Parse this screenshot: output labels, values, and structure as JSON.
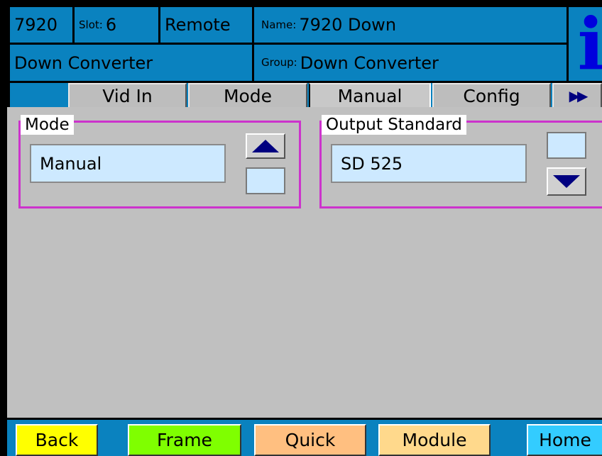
{
  "header": {
    "model": "7920",
    "slot_label": "Slot:",
    "slot_value": "6",
    "remote_label": "Remote",
    "name_label": "Name:",
    "name_value": "7920 Down",
    "device_type": "Down Converter",
    "group_label": "Group:",
    "group_value": "Down Converter",
    "info_glyph": "i"
  },
  "tabs": [
    {
      "label": "Vid In"
    },
    {
      "label": "Mode"
    },
    {
      "label": "Manual"
    },
    {
      "label": "Config"
    }
  ],
  "tabs_more_glyph": "▶▶",
  "mode_panel": {
    "title": "Mode",
    "value": "Manual"
  },
  "output_panel": {
    "title": "Output Standard",
    "value": "SD 525"
  },
  "footer": {
    "back": "Back",
    "frame": "Frame",
    "quick": "Quick",
    "module": "Module",
    "home": "Home"
  },
  "colors": {
    "header_bg": "#0a82bf",
    "panel_border": "#cc33cc",
    "field_bg": "#cde9ff",
    "back_btn": "#ffff00",
    "frame_btn": "#7fff00",
    "quick_btn": "#ffbf80",
    "module_btn": "#ffd98c",
    "home_btn": "#33ccff"
  }
}
